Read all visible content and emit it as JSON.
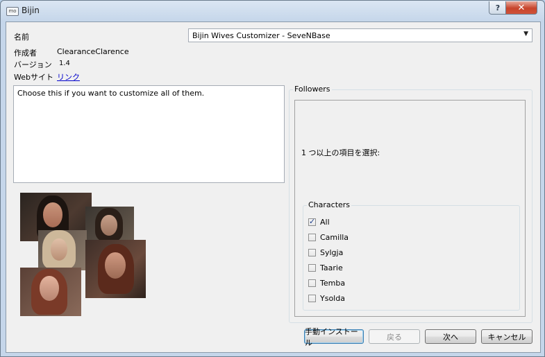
{
  "window": {
    "title": "Bijin",
    "app_icon_text": "mo"
  },
  "titlebar": {
    "help_label": "?",
    "close_label": "✕"
  },
  "info": {
    "name_label": "名前",
    "author_label": "作成者",
    "author_value": "ClearanceClarence",
    "version_label": "バージョン",
    "version_value": "1.4",
    "website_label": "Webサイト",
    "website_link": "リンク"
  },
  "plugin_select": {
    "selected": "Bijin Wives Customizer - SeveNBase"
  },
  "description": "Choose this if you want to customize all of them.",
  "followers": {
    "legend": "Followers",
    "prompt": "1 つ以上の項目を選択:",
    "characters_legend": "Characters",
    "items": [
      {
        "label": "All",
        "checked": true
      },
      {
        "label": "Camilla",
        "checked": false
      },
      {
        "label": "Sylgja",
        "checked": false
      },
      {
        "label": "Taarie",
        "checked": false
      },
      {
        "label": "Temba",
        "checked": false
      },
      {
        "label": "Ysolda",
        "checked": false
      }
    ]
  },
  "buttons": {
    "manual_install": "手動インストール",
    "back": "戻る",
    "next": "次へ",
    "cancel": "キャンセル"
  }
}
